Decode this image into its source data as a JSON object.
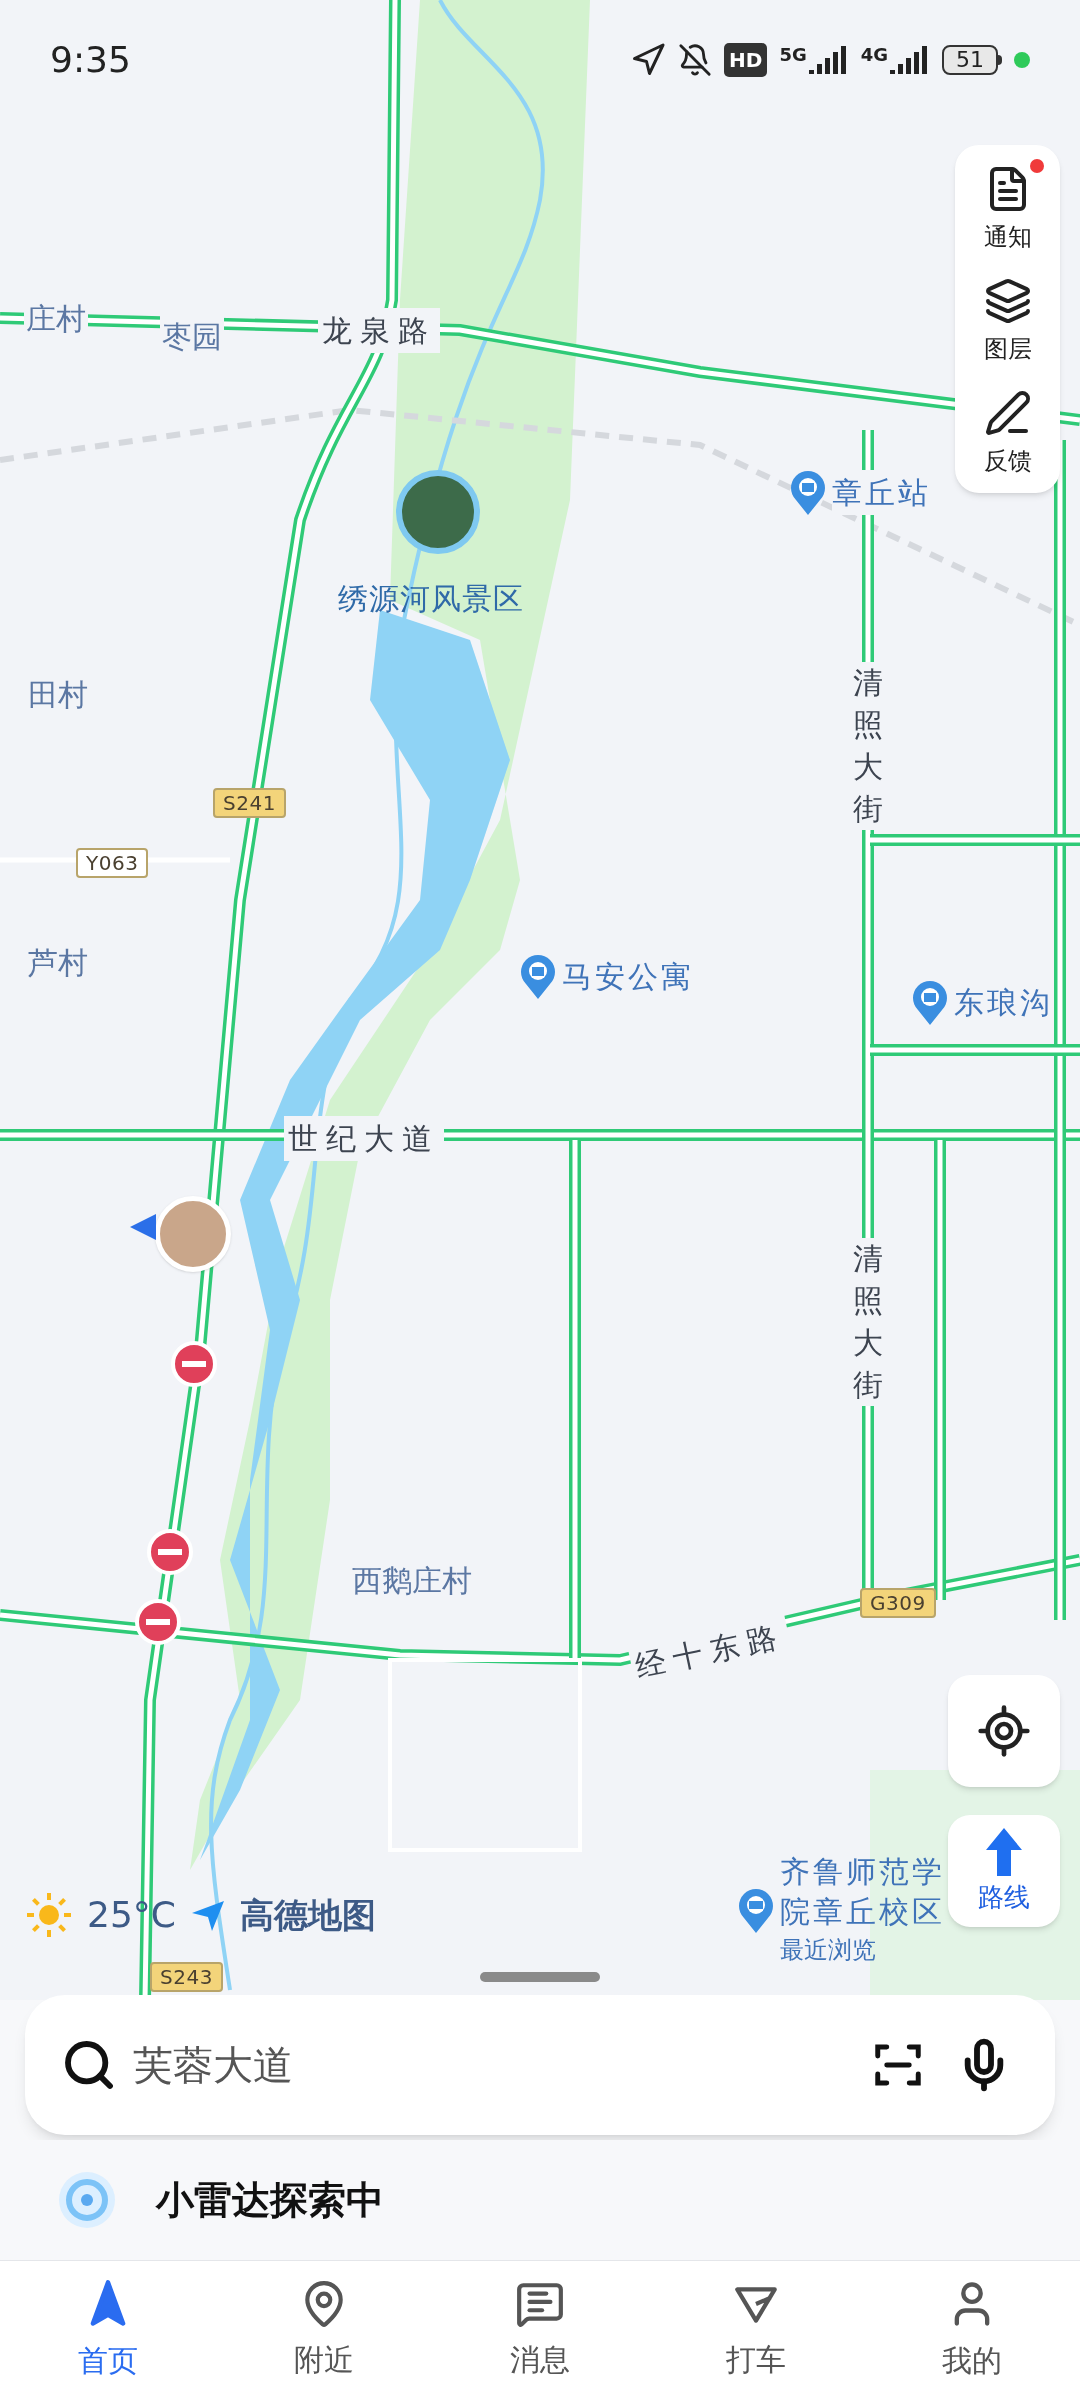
{
  "status_bar": {
    "time": "9:35",
    "hd": "HD",
    "sim1": "5G",
    "sim2": "4G",
    "battery": "51"
  },
  "map": {
    "labels": [
      {
        "kind": "place",
        "text": "庄村"
      },
      {
        "kind": "place",
        "text": "枣园"
      },
      {
        "kind": "road",
        "text": "龙泉路"
      },
      {
        "kind": "poi",
        "text": "章丘站"
      },
      {
        "kind": "photo_poi",
        "text": "绣源河风景区"
      },
      {
        "kind": "place",
        "text": "田村"
      },
      {
        "kind": "shield",
        "text": "S241",
        "color": "#f3d47a"
      },
      {
        "kind": "vertical_road",
        "text": "清照大街"
      },
      {
        "kind": "shield",
        "text": "Y063",
        "color": "#ffffff"
      },
      {
        "kind": "place",
        "text": "芦村"
      },
      {
        "kind": "poi",
        "text": "马安公寓"
      },
      {
        "kind": "poi",
        "text": "东琅沟"
      },
      {
        "kind": "road",
        "text": "世纪大道"
      },
      {
        "kind": "vertical_road",
        "text": "清照大街"
      },
      {
        "kind": "place",
        "text": "西鹅庄村"
      },
      {
        "kind": "shield",
        "text": "G309",
        "color": "#f3d47a"
      },
      {
        "kind": "road",
        "text": "经十东路"
      },
      {
        "kind": "shield",
        "text": "S243",
        "color": "#f3d47a"
      }
    ],
    "recent_poi": {
      "lines": [
        "齐鲁师范学",
        "院章丘校区"
      ],
      "tag": "最近浏览"
    }
  },
  "side_tools": [
    {
      "label": "通知",
      "unread": true
    },
    {
      "label": "图层",
      "unread": false
    },
    {
      "label": "反馈",
      "unread": false
    }
  ],
  "route_button": {
    "label": "路线"
  },
  "weather": {
    "temperature": "25°C",
    "brand": "高德地图"
  },
  "search": {
    "placeholder": "芙蓉大道"
  },
  "radar": {
    "text": "小雷达探索中"
  },
  "tabs": [
    {
      "label": "首页",
      "selected": true
    },
    {
      "label": "附近",
      "selected": false
    },
    {
      "label": "消息",
      "selected": false
    },
    {
      "label": "打车",
      "selected": false
    },
    {
      "label": "我的",
      "selected": false
    }
  ]
}
